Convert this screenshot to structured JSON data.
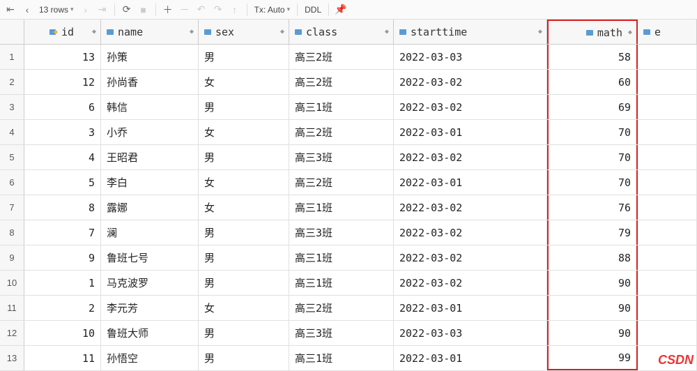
{
  "toolbar": {
    "rows_label": "13 rows",
    "tx_label": "Tx: Auto",
    "ddl_label": "DDL"
  },
  "columns": [
    {
      "key": "id",
      "label": "id",
      "icon": "key"
    },
    {
      "key": "name",
      "label": "name",
      "icon": "col"
    },
    {
      "key": "sex",
      "label": "sex",
      "icon": "col"
    },
    {
      "key": "class",
      "label": "class",
      "icon": "col"
    },
    {
      "key": "starttime",
      "label": "starttime",
      "icon": "col"
    },
    {
      "key": "math",
      "label": "math",
      "icon": "col"
    },
    {
      "key": "extra",
      "label": "e",
      "icon": "col"
    }
  ],
  "rows": [
    {
      "n": "1",
      "id": "13",
      "name": "孙策",
      "sex": "男",
      "class": "高三2班",
      "starttime": "2022-03-03",
      "math": "58"
    },
    {
      "n": "2",
      "id": "12",
      "name": "孙尚香",
      "sex": "女",
      "class": "高三2班",
      "starttime": "2022-03-02",
      "math": "60"
    },
    {
      "n": "3",
      "id": "6",
      "name": "韩信",
      "sex": "男",
      "class": "高三1班",
      "starttime": "2022-03-02",
      "math": "69"
    },
    {
      "n": "4",
      "id": "3",
      "name": "小乔",
      "sex": "女",
      "class": "高三2班",
      "starttime": "2022-03-01",
      "math": "70"
    },
    {
      "n": "5",
      "id": "4",
      "name": "王昭君",
      "sex": "男",
      "class": "高三3班",
      "starttime": "2022-03-02",
      "math": "70"
    },
    {
      "n": "6",
      "id": "5",
      "name": "李白",
      "sex": "女",
      "class": "高三2班",
      "starttime": "2022-03-01",
      "math": "70"
    },
    {
      "n": "7",
      "id": "8",
      "name": "露娜",
      "sex": "女",
      "class": "高三1班",
      "starttime": "2022-03-02",
      "math": "76"
    },
    {
      "n": "8",
      "id": "7",
      "name": "澜",
      "sex": "男",
      "class": "高三3班",
      "starttime": "2022-03-02",
      "math": "79"
    },
    {
      "n": "9",
      "id": "9",
      "name": "鲁班七号",
      "sex": "男",
      "class": "高三1班",
      "starttime": "2022-03-02",
      "math": "88"
    },
    {
      "n": "10",
      "id": "1",
      "name": "马克波罗",
      "sex": "男",
      "class": "高三1班",
      "starttime": "2022-03-02",
      "math": "90"
    },
    {
      "n": "11",
      "id": "2",
      "name": "李元芳",
      "sex": "女",
      "class": "高三2班",
      "starttime": "2022-03-01",
      "math": "90"
    },
    {
      "n": "12",
      "id": "10",
      "name": "鲁班大师",
      "sex": "男",
      "class": "高三3班",
      "starttime": "2022-03-03",
      "math": "90"
    },
    {
      "n": "13",
      "id": "11",
      "name": "孙悟空",
      "sex": "男",
      "class": "高三1班",
      "starttime": "2022-03-01",
      "math": "99"
    }
  ],
  "watermark": "CSDN"
}
